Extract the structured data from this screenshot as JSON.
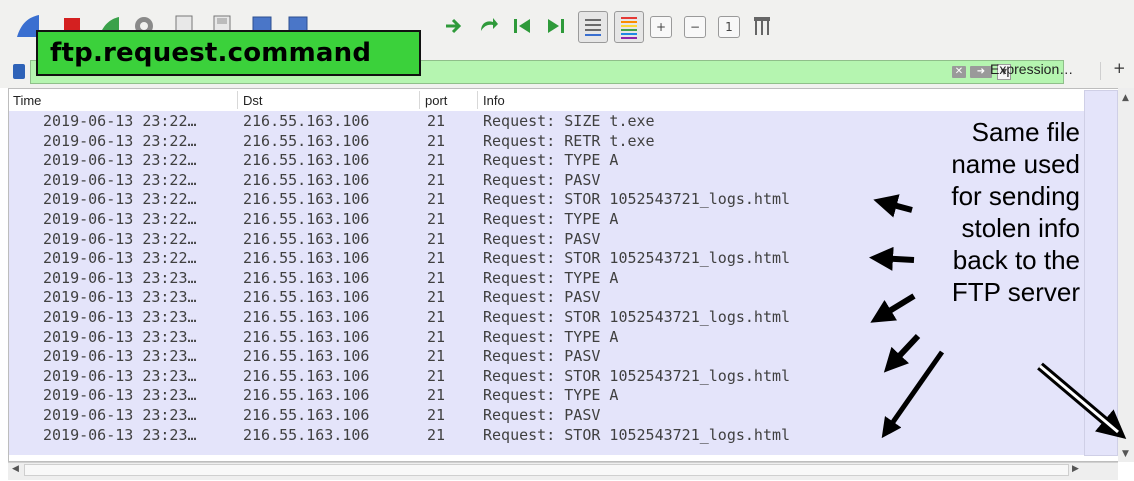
{
  "filter": {
    "overlay_label": "ftp.request.command",
    "expression_label": "Expression…",
    "plus_label": "+"
  },
  "columns": [
    "Time",
    "Dst",
    "port",
    "Info"
  ],
  "rows": [
    {
      "time": "2019-06-13 23:22…",
      "dst": "216.55.163.106",
      "port": "21",
      "info": "Request: SIZE t.exe"
    },
    {
      "time": "2019-06-13 23:22…",
      "dst": "216.55.163.106",
      "port": "21",
      "info": "Request: RETR t.exe"
    },
    {
      "time": "2019-06-13 23:22…",
      "dst": "216.55.163.106",
      "port": "21",
      "info": "Request: TYPE A"
    },
    {
      "time": "2019-06-13 23:22…",
      "dst": "216.55.163.106",
      "port": "21",
      "info": "Request: PASV"
    },
    {
      "time": "2019-06-13 23:22…",
      "dst": "216.55.163.106",
      "port": "21",
      "info": "Request: STOR 1052543721_logs.html"
    },
    {
      "time": "2019-06-13 23:22…",
      "dst": "216.55.163.106",
      "port": "21",
      "info": "Request: TYPE A"
    },
    {
      "time": "2019-06-13 23:22…",
      "dst": "216.55.163.106",
      "port": "21",
      "info": "Request: PASV"
    },
    {
      "time": "2019-06-13 23:22…",
      "dst": "216.55.163.106",
      "port": "21",
      "info": "Request: STOR 1052543721_logs.html"
    },
    {
      "time": "2019-06-13 23:23…",
      "dst": "216.55.163.106",
      "port": "21",
      "info": "Request: TYPE A"
    },
    {
      "time": "2019-06-13 23:23…",
      "dst": "216.55.163.106",
      "port": "21",
      "info": "Request: PASV"
    },
    {
      "time": "2019-06-13 23:23…",
      "dst": "216.55.163.106",
      "port": "21",
      "info": "Request: STOR 1052543721_logs.html"
    },
    {
      "time": "2019-06-13 23:23…",
      "dst": "216.55.163.106",
      "port": "21",
      "info": "Request: TYPE A"
    },
    {
      "time": "2019-06-13 23:23…",
      "dst": "216.55.163.106",
      "port": "21",
      "info": "Request: PASV"
    },
    {
      "time": "2019-06-13 23:23…",
      "dst": "216.55.163.106",
      "port": "21",
      "info": "Request: STOR 1052543721_logs.html"
    },
    {
      "time": "2019-06-13 23:23…",
      "dst": "216.55.163.106",
      "port": "21",
      "info": "Request: TYPE A"
    },
    {
      "time": "2019-06-13 23:23…",
      "dst": "216.55.163.106",
      "port": "21",
      "info": "Request: PASV"
    },
    {
      "time": "2019-06-13 23:23…",
      "dst": "216.55.163.106",
      "port": "21",
      "info": "Request: STOR 1052543721_logs.html"
    }
  ],
  "annotation": {
    "lines": [
      "Same file",
      "name used",
      "for sending",
      "stolen info",
      "back to the",
      "FTP server"
    ]
  },
  "colors": {
    "filter_valid": "#b5f5b0",
    "callout": "#3bd13b",
    "row_highlight": "#e4e4fa"
  }
}
